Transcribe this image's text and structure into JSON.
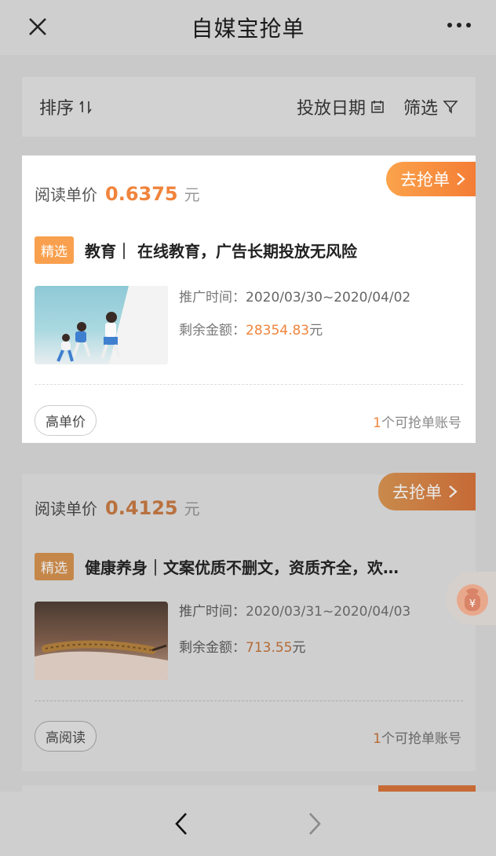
{
  "header": {
    "title": "自媒宝抢单",
    "close_icon": "close-icon",
    "more_icon": "more-icon"
  },
  "filter": {
    "sort_label": "排序",
    "date_label": "投放日期",
    "filter_label": "筛选"
  },
  "cards": [
    {
      "grab_label": "去抢单",
      "price_label": "阅读单价",
      "price": "0.6375",
      "unit": "元",
      "tag": "精选",
      "title": "教育｜ 在线教育，广告长期投放无风险",
      "time_label": "推广时间：",
      "time_value": "2020/03/30~2020/04/02",
      "amount_label": "剩余金额：",
      "amount_value": "28354.83",
      "amount_unit": "元",
      "badge": "高单价",
      "accounts_num": "1",
      "accounts_text": "个可抢单账号"
    },
    {
      "grab_label": "去抢单",
      "price_label": "阅读单价",
      "price": "0.4125",
      "unit": "元",
      "tag": "精选",
      "title": "健康养身｜文案优质不删文，资质齐全，欢…",
      "time_label": "推广时间：",
      "time_value": "2020/03/31~2020/04/03",
      "amount_label": "剩余金额：",
      "amount_value": "713.55",
      "amount_unit": "元",
      "badge": "高阅读",
      "accounts_num": "1",
      "accounts_text": "个可抢单账号"
    }
  ],
  "footer": {
    "back_icon": "chevron-left-icon",
    "forward_icon": "chevron-right-icon"
  },
  "colors": {
    "accent": "#f0843c",
    "tag": "#f9a04e",
    "overlay": "#c9c9c9"
  }
}
